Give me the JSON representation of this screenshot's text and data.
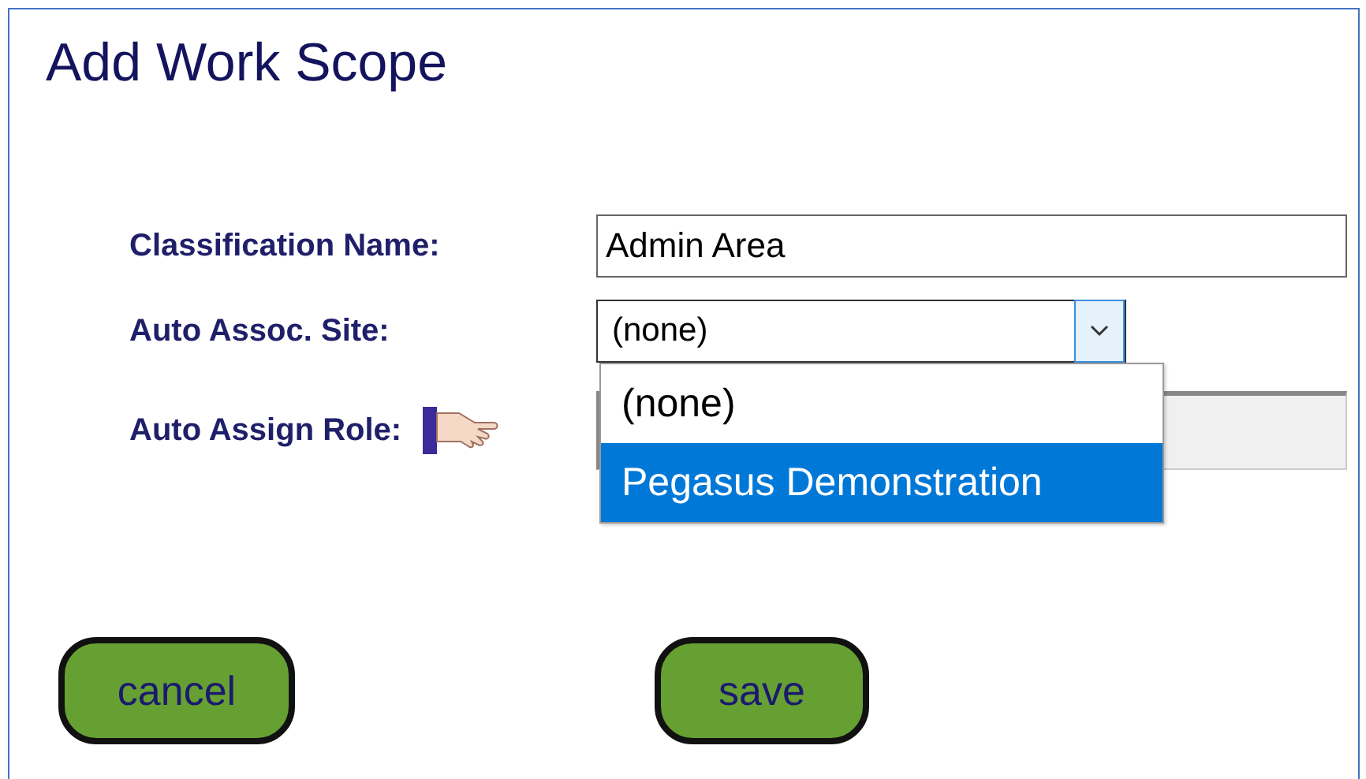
{
  "title": "Add Work Scope",
  "fields": [
    {
      "kind": "text",
      "label": "Classification Name:",
      "value": "Admin Area"
    },
    {
      "kind": "select",
      "label": "Auto Assoc. Site:",
      "value": "(none)",
      "expanded": true,
      "options": [
        {
          "label": "(none)",
          "highlighted": false
        },
        {
          "label": "Pegasus Demonstration",
          "highlighted": true
        }
      ]
    },
    {
      "kind": "role",
      "label": "Auto Assign Role:",
      "disabled": true
    }
  ],
  "buttons": [
    {
      "label": "cancel"
    },
    {
      "label": "save"
    }
  ]
}
